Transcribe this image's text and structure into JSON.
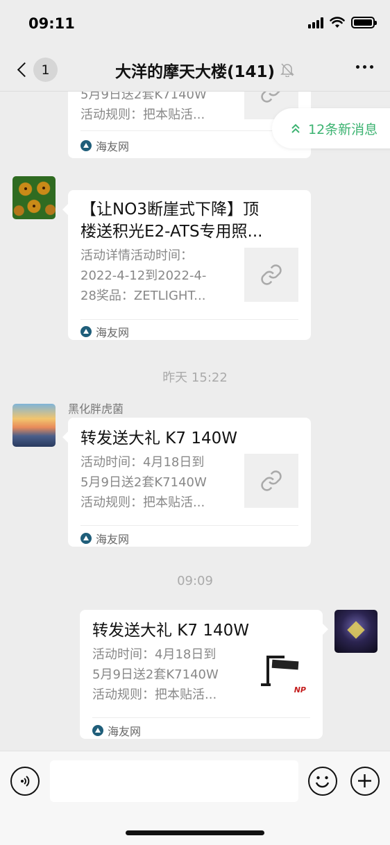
{
  "status": {
    "time": "09:11"
  },
  "nav": {
    "unread": "1",
    "title": "大洋的摩天大楼(141)"
  },
  "new_messages": {
    "label": "12条新消息"
  },
  "messages": [
    {
      "title": "",
      "desc_lines": [
        "5月9日送2套K7140W",
        "活动规则：把本贴活..."
      ],
      "source": "海友网"
    },
    {
      "title_lines": [
        "【让NO3断崖式下降】顶",
        "楼送积光E2-ATS专用照..."
      ],
      "desc_lines": [
        "活动详情活动时间：",
        "2022-4-12到2022-4-",
        "28奖品：ZETLIGHT..."
      ],
      "source": "海友网"
    },
    {
      "timestamp": "昨天 15:22",
      "sender": "黑化胖虎菌",
      "title": "转发送大礼 K7 140W",
      "desc_lines": [
        "活动时间：4月18日到",
        "5月9日送2套K7140W",
        "活动规则：把本贴活..."
      ],
      "source": "海友网"
    },
    {
      "timestamp": "09:09",
      "title": "转发送大礼 K7 140W",
      "desc_lines": [
        "活动时间：4月18日到",
        "5月9日送2套K7140W",
        "活动规则：把本贴活..."
      ],
      "source": "海友网",
      "thumb_brand": "NP"
    }
  ],
  "colors": {
    "accent_green": "#3cb371",
    "background": "#ededed"
  }
}
